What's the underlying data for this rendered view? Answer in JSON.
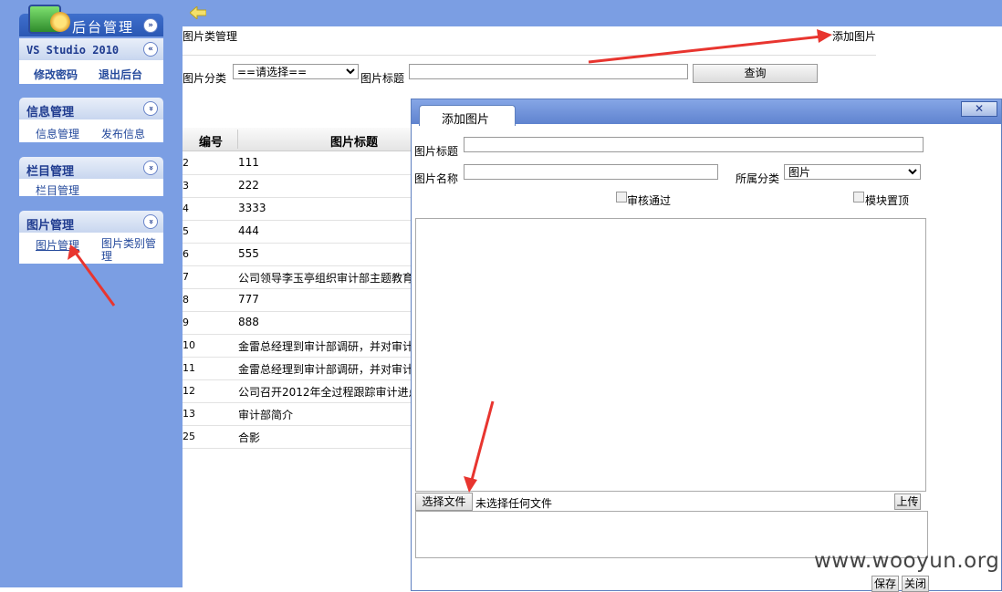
{
  "sidebar": {
    "app_title": "后台管理",
    "version": "VS Studio 2010",
    "account_links": [
      "修改密码",
      "退出后台"
    ],
    "panels": [
      {
        "title": "信息管理",
        "links": [
          "信息管理",
          "发布信息"
        ]
      },
      {
        "title": "栏目管理",
        "links": [
          "栏目管理"
        ]
      },
      {
        "title": "图片管理",
        "links": [
          "图片管理",
          "图片类别管理"
        ]
      }
    ],
    "toggle_symbol": "»"
  },
  "page": {
    "title": "图片类管理",
    "add_link": "添加图片",
    "filter": {
      "category_label": "图片分类",
      "category_selected": "==请选择==",
      "title_label": "图片标题",
      "title_value": "",
      "query_button": "查询"
    }
  },
  "table": {
    "headers": [
      "编号",
      "图片标题"
    ],
    "rows": [
      {
        "id": "2",
        "title": "111"
      },
      {
        "id": "3",
        "title": "222"
      },
      {
        "id": "4",
        "title": "3333"
      },
      {
        "id": "5",
        "title": "444"
      },
      {
        "id": "6",
        "title": "555"
      },
      {
        "id": "7",
        "title": "公司领导李玉亭组织审计部主题教育"
      },
      {
        "id": "8",
        "title": "777"
      },
      {
        "id": "9",
        "title": "888"
      },
      {
        "id": "10",
        "title": "金雷总经理到审计部调研，并对审计"
      },
      {
        "id": "11",
        "title": "金雷总经理到审计部调研，并对审计"
      },
      {
        "id": "12",
        "title": "公司召开2012年全过程跟踪审计进点"
      },
      {
        "id": "13",
        "title": "审计部简介"
      },
      {
        "id": "25",
        "title": "合影"
      }
    ]
  },
  "dialog": {
    "tab_label": "添加图片",
    "close_symbol": "✕",
    "title_label": "图片标题",
    "title_value": "",
    "name_label": "图片名称",
    "name_value": "",
    "category_label": "所属分类",
    "category_selected": "图片",
    "checkbox_approved": "审核通过",
    "checkbox_top": "模块置顶",
    "file_button": "选择文件",
    "file_status": "未选择任何文件",
    "upload_button": "上传",
    "save_button": "保存",
    "close_button": "关闭"
  },
  "watermark": "www.wooyun.org",
  "colors": {
    "sidebar_bg": "#7b9ee3",
    "link": "#254a9c",
    "arrow": "#e8352f"
  }
}
